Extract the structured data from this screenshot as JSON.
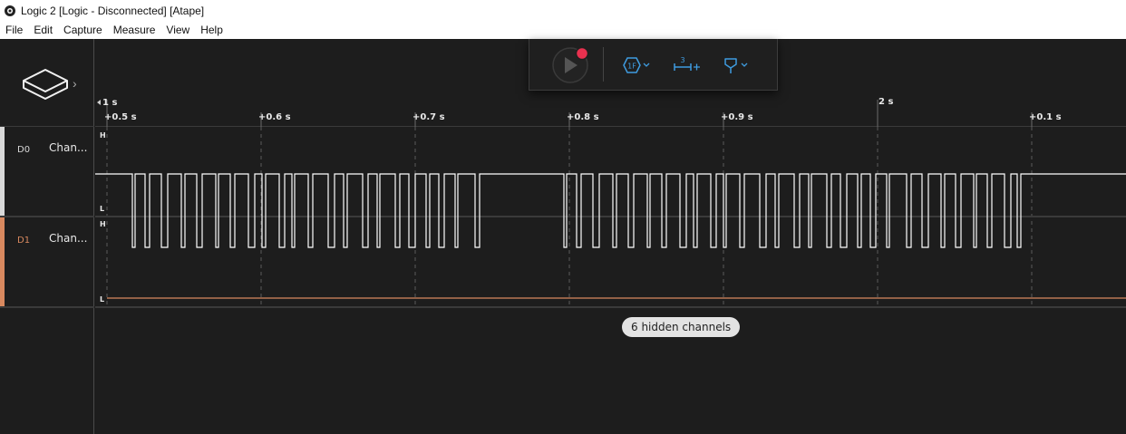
{
  "window": {
    "title": "Logic 2 [Logic - Disconnected] [Atape]"
  },
  "menu": [
    "File",
    "Edit",
    "Capture",
    "Measure",
    "View",
    "Help"
  ],
  "toolbar": {
    "record_button": "play-record-button",
    "trigger_label": "1F",
    "measure_label": "3"
  },
  "timeline": {
    "major_start": "1 s",
    "major_mid": "2 s",
    "ticks": [
      "+0.5 s",
      "+0.6 s",
      "+0.7 s",
      "+0.8 s",
      "+0.9 s",
      "+0.1 s"
    ]
  },
  "channels": [
    {
      "id": "D0",
      "name": "Chan...",
      "color": "#d9d9d9",
      "high": "H",
      "low": "L"
    },
    {
      "id": "D1",
      "name": "Chan...",
      "color": "#d9895f",
      "high": "H",
      "low": "L"
    }
  ],
  "hidden_channels": "6 hidden channels",
  "colors": {
    "accent_record": "#e8314f",
    "accent_blue": "#3f9ce0",
    "d1_trace": "#d9895f"
  }
}
